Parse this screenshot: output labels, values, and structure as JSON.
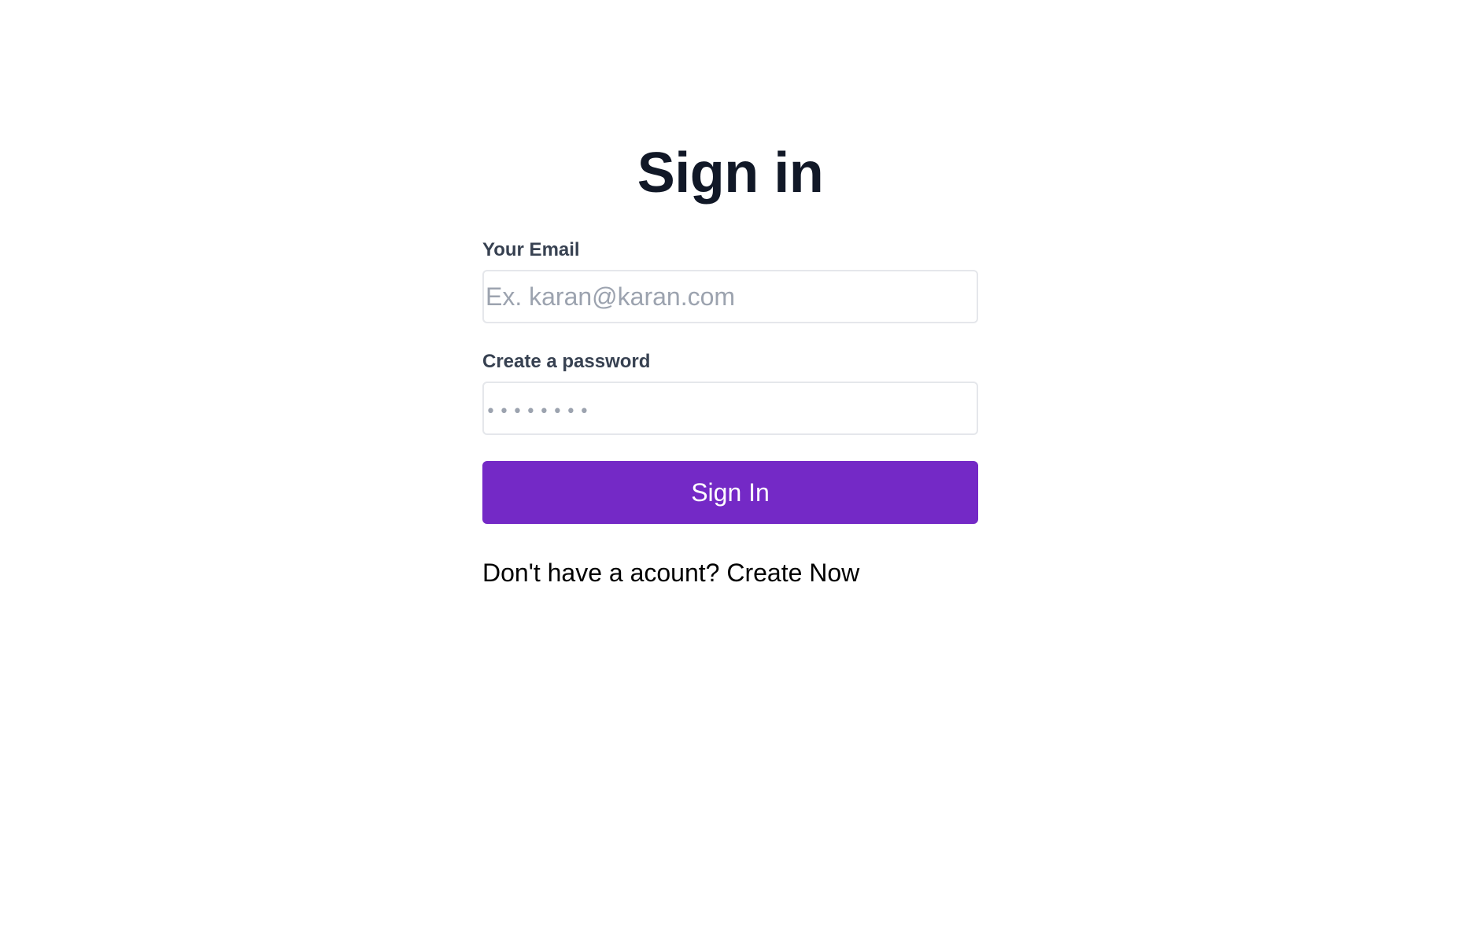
{
  "page": {
    "title": "Sign in"
  },
  "form": {
    "email": {
      "label": "Your Email",
      "value": "",
      "placeholder": "Ex. karan@karan.com"
    },
    "password": {
      "label": "Create a password",
      "value": "",
      "placeholder": "••••••••"
    },
    "submit_label": "Sign In"
  },
  "footer": {
    "prompt_text": "Don't have a acount?",
    "link_text": "Create Now"
  },
  "colors": {
    "accent": "#7429c6",
    "title": "#111827",
    "label": "#374151",
    "placeholder": "#9ca3af",
    "input_border": "#e5e7eb"
  }
}
